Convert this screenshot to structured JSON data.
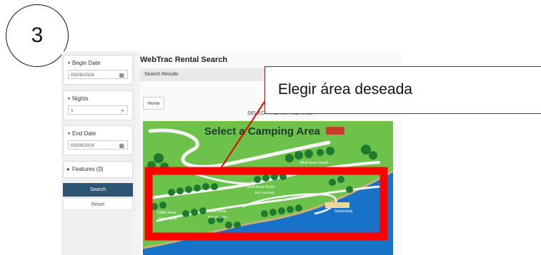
{
  "step_number": "3",
  "callout": {
    "text": "Elegir área deseada",
    "color": "#e00000"
  },
  "sidebar": {
    "begin_date": {
      "label": "Begin Date",
      "value": "05/08/2024"
    },
    "nights": {
      "label": "Nights",
      "value": "1"
    },
    "end_date": {
      "label": "End Date",
      "value": "05/09/2024"
    },
    "features": {
      "label": "Features (0)"
    },
    "search_label": "Search",
    "reset_label": "Reset"
  },
  "app": {
    "title": "WebTrac Rental Search",
    "results_label": "Search Results",
    "home_label": "Home",
    "section_heading": "SELECT A CAMPING AREA"
  },
  "map": {
    "title": "Select a Camping Area",
    "areas": [
      {
        "name": "Bluff Area South"
      },
      {
        "name": "Bluff Area North",
        "sub": "Tent Camping"
      },
      {
        "name": "Grove Area",
        "sub": "Tent Camping"
      },
      {
        "name": "Utility Area",
        "sub": "RV Camping"
      },
      {
        "name": "Swimming"
      }
    ]
  },
  "colors": {
    "accent_button": "#2d5571",
    "highlight_box": "#ff0000",
    "map_grass": "#6cc24a",
    "river": "#1673c8"
  }
}
